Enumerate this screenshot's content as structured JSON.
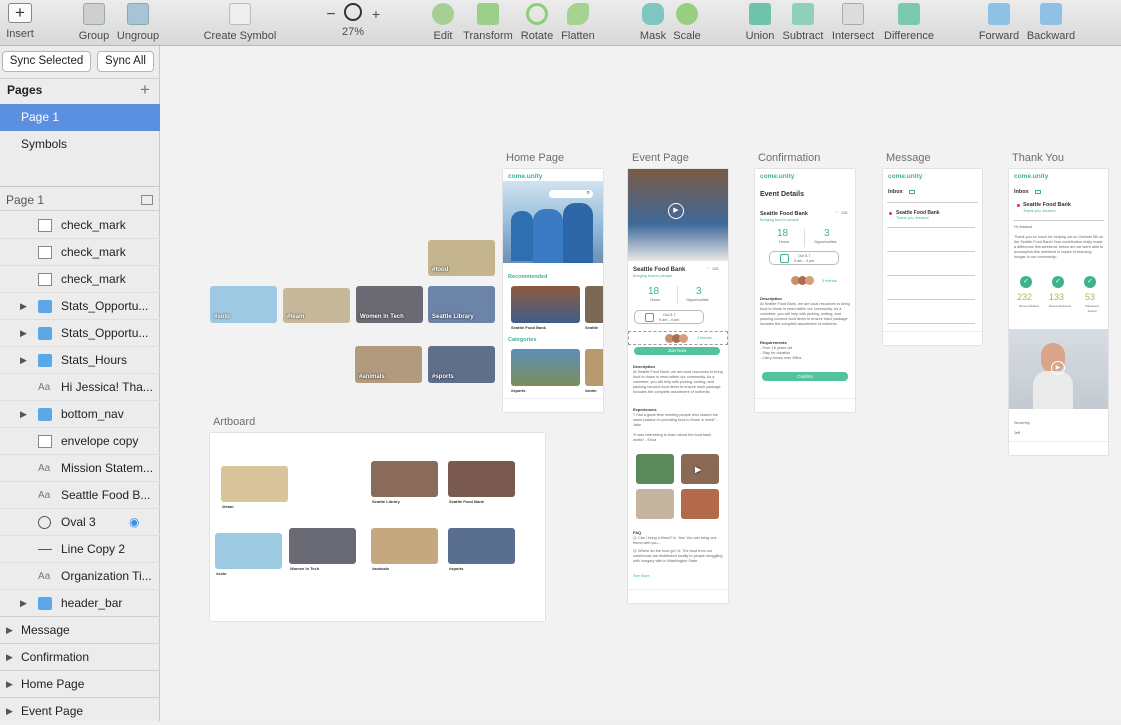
{
  "toolbar": {
    "insert": "Insert",
    "group": "Group",
    "ungroup": "Ungroup",
    "create_symbol": "Create Symbol",
    "zoom_minus": "−",
    "zoom_plus": "+",
    "zoom_level": "27%",
    "edit": "Edit",
    "transform": "Transform",
    "rotate": "Rotate",
    "flatten": "Flatten",
    "mask": "Mask",
    "scale": "Scale",
    "union": "Union",
    "subtract": "Subtract",
    "intersect": "Intersect",
    "difference": "Difference",
    "forward": "Forward",
    "backward": "Backward"
  },
  "sidebar": {
    "sync_selected": "Sync Selected",
    "sync_all": "Sync All",
    "pages_title": "Pages",
    "pages": [
      {
        "label": "Page 1",
        "selected": true
      },
      {
        "label": "Symbols",
        "selected": false
      }
    ],
    "layer_page_title": "Page 1",
    "layers": [
      {
        "label": "check_mark",
        "icon": "image-icon"
      },
      {
        "label": "check_mark",
        "icon": "image-icon"
      },
      {
        "label": "check_mark",
        "icon": "image-icon"
      },
      {
        "label": "Stats_Opportu...",
        "icon": "folder-icon"
      },
      {
        "label": "Stats_Opportu...",
        "icon": "folder-icon"
      },
      {
        "label": "Stats_Hours",
        "icon": "folder-icon"
      },
      {
        "label": "Hi Jessica! Tha...",
        "icon": "text-icon"
      },
      {
        "label": "bottom_nav",
        "icon": "folder-icon"
      },
      {
        "label": "envelope copy",
        "icon": "image-icon"
      },
      {
        "label": "Mission Statem...",
        "icon": "text-icon"
      },
      {
        "label": "Seattle Food B...",
        "icon": "text-icon"
      },
      {
        "label": "Oval 3",
        "icon": "oval-icon"
      },
      {
        "label": "Line Copy 2",
        "icon": "line-icon"
      },
      {
        "label": "Organization Ti...",
        "icon": "text-icon"
      },
      {
        "label": "header_bar",
        "icon": "folder-icon"
      }
    ],
    "groups": [
      "Message",
      "Confirmation",
      "Home Page",
      "Event Page"
    ]
  },
  "canvas": {
    "artboard_labels": {
      "home": "Home Page",
      "event": "Event Page",
      "confirmation": "Confirmation",
      "message": "Message",
      "thankyou": "Thank You",
      "artboard": "Artboard"
    },
    "loose_tiles": [
      "#solo",
      "#team",
      "Women In Tech",
      "Seattle Library",
      "#food",
      "#animals",
      "#sports"
    ],
    "artboard_tiles": [
      "#team",
      "Seattle Library",
      "Seattle Food Bank",
      "#solo",
      "Women In Tech",
      "#animals",
      "#sports"
    ],
    "brand": "come.unity",
    "home": {
      "recommended": "Recommended",
      "categories": "Categories",
      "card1": "Seattle Food Bank",
      "card2": "Seattle",
      "cat1": "#sports",
      "cat2": "#anim"
    },
    "event": {
      "title": "Seattle Food Bank",
      "subtitle": "Bringing food to people",
      "count_label": "126",
      "hours": "18",
      "hours_label": "Hours",
      "opportunities": "3",
      "opportunities_label": "Opportunities",
      "date": "Oct 5-7",
      "time": "9 am - 4 pm",
      "friends": "3 friends",
      "join": "Join Now",
      "description_title": "Description",
      "description": "At Seattle Food Bank, we are local resources to bring food to those in need within our community. As a volunteer, you will help with picking, sorting, and packing coconut food items to ensure each package includes the complete assortment of nutrients.",
      "experiences_title": "Experiences",
      "quote1": "“I had a great time meeting people who shared the same passion in providing food to those in need!” - Jake",
      "quote2": "“It was interesting to learn about the food bank works” - Erica",
      "faq_title": "FAQ",
      "faq1": "Q: Can I bring a friend? A: Yes! You can bring one friend with you...",
      "faq2": "Q: Where do the food go? A: The food from our warehouse are distributed locally to people struggling with hungary with in Washington State.",
      "see_more": "See More"
    },
    "confirmation": {
      "header": "Event Details",
      "title": "Seattle Food Bank",
      "subtitle": "Bringing food to people",
      "count_label": "126",
      "hours": "18",
      "hours_label": "Hours",
      "opportunities": "3",
      "opportunities_label": "Opportunities",
      "date": "Oct 5-7",
      "time": "9 am - 4 pm",
      "friends": "3 friends",
      "description_title": "Description",
      "description": "At Seattle Food Bank, we are local resources to bring food to those in need within our community. As a volunteer, you will help with picking, sorting, and packing coconut food items to ensure each package includes the complete assortment of nutrients.",
      "requirements_title": "Requirements",
      "requirements": "- Over 16 years old\n- Stay for duration\n- Carry boxes over 35lbs",
      "confirm": "Confirm"
    },
    "message": {
      "inbox": "Inbox",
      "item_title": "Seattle Food Bank",
      "item_sub": "Thank you Jessica!"
    },
    "thankyou": {
      "inbox": "Inbox",
      "title": "Seattle Food Bank",
      "sub": "Thank you Jessica!",
      "greeting": "Hi Jessica!",
      "body": "Thank you so much for helping out on October 5th at the Seattle Food Bank! Your contribution really made a difference this weekend, below are we were able to accomplish this weekend in hopes of reducing hunger in our community:",
      "stat1": "232",
      "stat1_label": "Boxes Packed",
      "stat2": "133",
      "stat2_label": "Boxes Delivered",
      "stat3": "53",
      "stat3_label": "Volunteers Joined",
      "sign": "Sincerely,",
      "name": "Jeff"
    }
  },
  "colors": {
    "accent_green": "#3cb38f",
    "selection_blue": "#5b8fe0",
    "eye_blue": "#3c8ee8"
  }
}
